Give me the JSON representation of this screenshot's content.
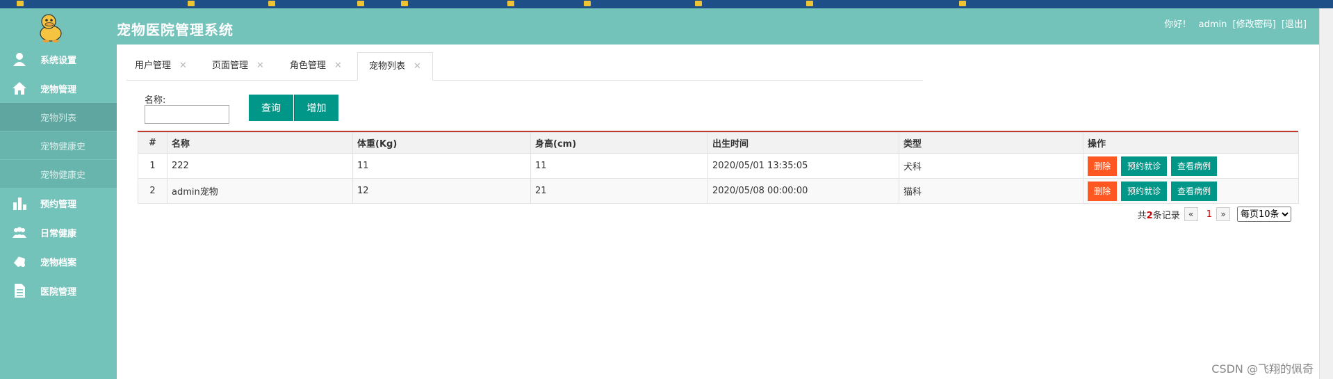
{
  "header": {
    "title": "宠物医院管理系统",
    "greeting": "你好!",
    "username": "admin",
    "change_password": "[修改密码]",
    "logout": "[退出]"
  },
  "sidebar": {
    "items": [
      {
        "label": "系统设置",
        "icon": "user-icon"
      },
      {
        "label": "宠物管理",
        "icon": "home-icon"
      },
      {
        "label": "宠物列表",
        "sub": true
      },
      {
        "label": "宠物健康史",
        "sub": true
      },
      {
        "label": "宠物健康史",
        "sub": true
      },
      {
        "label": "预约管理",
        "icon": "bar-chart-icon"
      },
      {
        "label": "日常健康",
        "icon": "group-icon"
      },
      {
        "label": "宠物档案",
        "icon": "paw-icon"
      },
      {
        "label": "医院管理",
        "icon": "document-icon"
      }
    ]
  },
  "tabs": [
    {
      "label": "用户管理"
    },
    {
      "label": "页面管理"
    },
    {
      "label": "角色管理"
    },
    {
      "label": "宠物列表",
      "active": true
    }
  ],
  "search": {
    "label": "名称:",
    "value": "",
    "query_button": "查询",
    "add_button": "增加"
  },
  "table": {
    "columns": [
      "#",
      "名称",
      "体重(Kg)",
      "身高(cm)",
      "出生时间",
      "类型",
      "操作"
    ],
    "rows": [
      {
        "index": "1",
        "name": "222",
        "weight": "11",
        "height": "11",
        "birth": "2020/05/01 13:35:05",
        "type": "犬科"
      },
      {
        "index": "2",
        "name": "admin宠物",
        "weight": "12",
        "height": "21",
        "birth": "2020/05/08 00:00:00",
        "type": "猫科"
      }
    ],
    "actions": {
      "delete": "删除",
      "appointment": "预约就诊",
      "case": "查看病例"
    }
  },
  "pager": {
    "total_prefix": "共",
    "total": "2",
    "total_suffix": "条记录",
    "prev": "«",
    "current": "1",
    "next": "»",
    "page_size": "每页10条"
  },
  "watermark": "CSDN @飞翔的佩奇",
  "colors": {
    "primary": "#74c3ba",
    "button": "#009688",
    "danger": "#ff5722",
    "table_accent": "#c0392b"
  }
}
